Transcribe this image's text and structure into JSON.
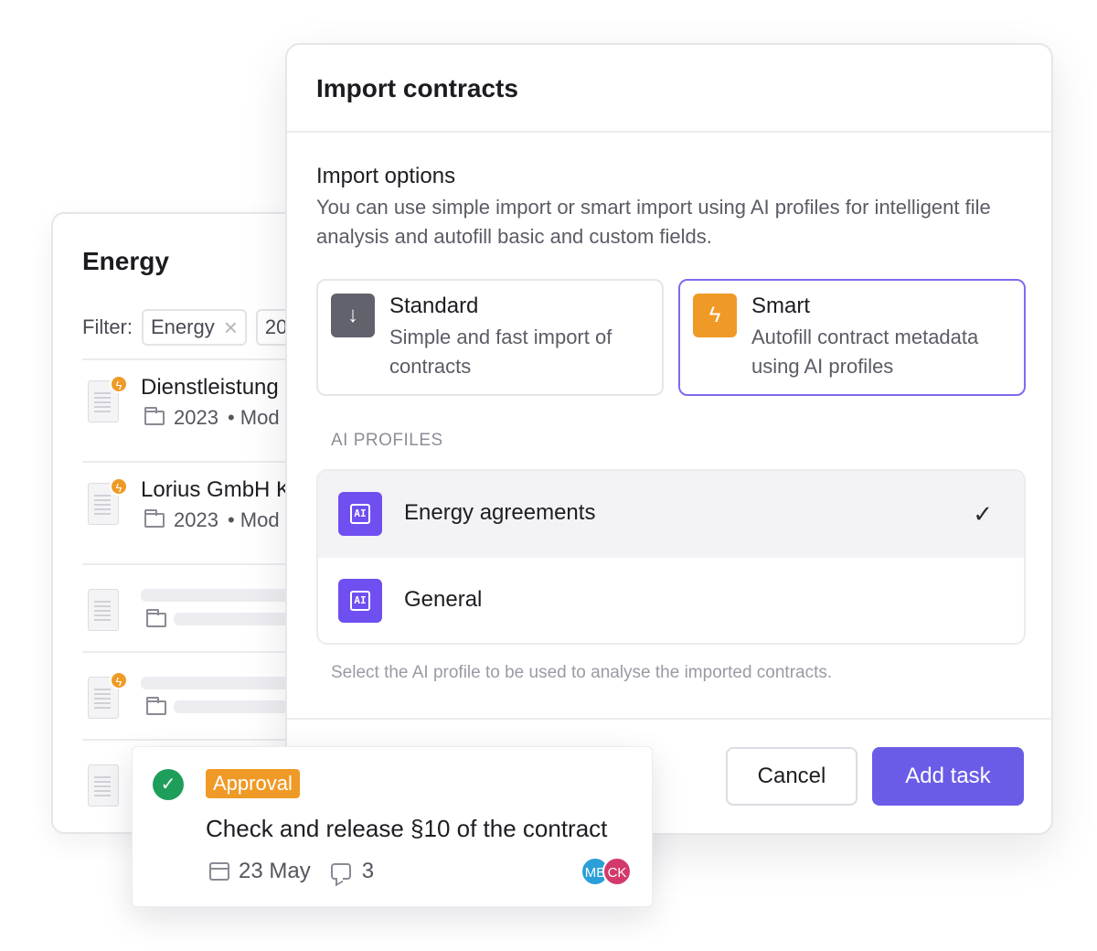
{
  "energy_panel": {
    "title": "Energy",
    "filter_label": "Filter:",
    "filters": [
      "Energy",
      "20"
    ],
    "rows": [
      {
        "title": "Dienstleistung",
        "year": "2023",
        "meta_suffix": "• Mod"
      },
      {
        "title": "Lorius GmbH K",
        "year": "2023",
        "meta_suffix": "• Mod"
      }
    ]
  },
  "modal": {
    "title": "Import contracts",
    "section_title": "Import options",
    "section_desc": "You can use simple import or smart import using AI profiles for intelligent file analysis and autofill basic and custom fields.",
    "options": [
      {
        "title": "Standard",
        "desc": "Simple and fast import of contracts",
        "icon": "↓",
        "icon_name": "download-arrow-icon",
        "selected": false
      },
      {
        "title": "Smart",
        "desc": "Autofill contract metadata using AI profiles",
        "icon": "ϟ",
        "icon_name": "lightning-bolt-icon",
        "selected": true
      }
    ],
    "profiles_label": "AI PROFILES",
    "profiles": [
      {
        "name": "Energy agreements",
        "icon_text": "AI",
        "selected": true
      },
      {
        "name": "General",
        "icon_text": "AI",
        "selected": false
      }
    ],
    "helper_text": "Select the AI profile to be used to analyse the imported contracts.",
    "cancel_label": "Cancel",
    "submit_label": "Add task"
  },
  "task_card": {
    "badge": "Approval",
    "title": "Check and release §10 of the contract",
    "date": "23 May",
    "comments": "3",
    "avatars": [
      "MB",
      "CK"
    ]
  },
  "colors": {
    "accent": "#6b5ce7",
    "selected_border": "#7c6cf0",
    "orange": "#ef9a26",
    "ai_purple": "#6f4ff0",
    "success": "#1f9d5b"
  }
}
